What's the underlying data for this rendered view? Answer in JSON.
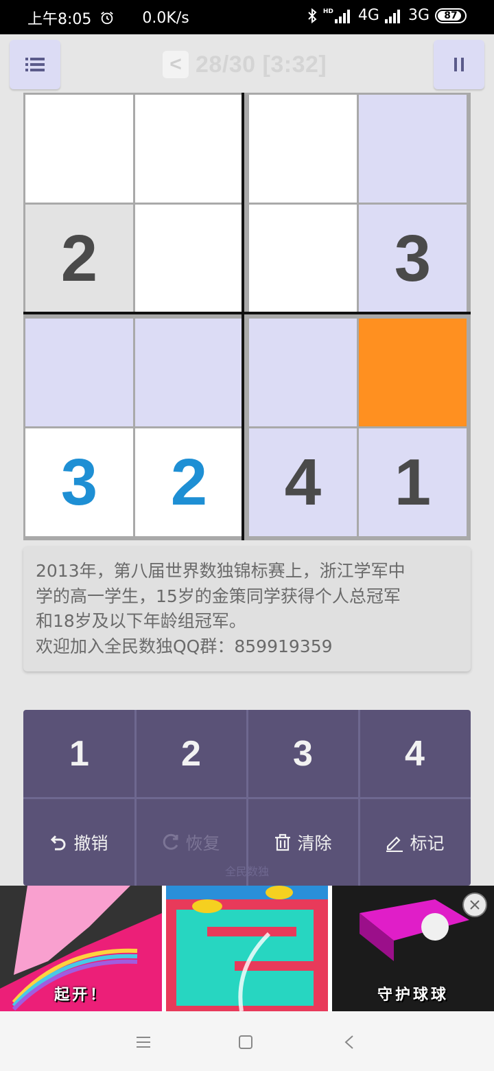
{
  "status_bar": {
    "time": "上午8:05",
    "net_speed": "0.0K/s",
    "net1": "4G",
    "net2": "3G",
    "hd": "HD",
    "battery": "87",
    "icons": [
      "alarm-icon",
      "bluetooth-icon",
      "signal-icon",
      "signal-icon"
    ]
  },
  "header": {
    "title": "28/30 [3:32]",
    "back_label": "<",
    "icons": [
      "menu-icon",
      "pause-icon"
    ]
  },
  "board": {
    "size": 4,
    "rows": [
      [
        {
          "v": "",
          "bg": "white"
        },
        {
          "v": "",
          "bg": "white"
        },
        {
          "v": "",
          "bg": "white"
        },
        {
          "v": "",
          "bg": "highlight"
        }
      ],
      [
        {
          "v": "2",
          "bg": "gray",
          "kind": "given"
        },
        {
          "v": "",
          "bg": "white"
        },
        {
          "v": "",
          "bg": "white"
        },
        {
          "v": "3",
          "bg": "highlight",
          "kind": "given"
        }
      ],
      [
        {
          "v": "",
          "bg": "highlight"
        },
        {
          "v": "",
          "bg": "highlight"
        },
        {
          "v": "",
          "bg": "highlight"
        },
        {
          "v": "",
          "bg": "selected"
        }
      ],
      [
        {
          "v": "3",
          "bg": "white",
          "kind": "user"
        },
        {
          "v": "2",
          "bg": "white",
          "kind": "user"
        },
        {
          "v": "4",
          "bg": "highlight",
          "kind": "given"
        },
        {
          "v": "1",
          "bg": "highlight",
          "kind": "given"
        }
      ]
    ]
  },
  "info": {
    "line1": "2013年，第八届世界数独锦标赛上，浙江学军中",
    "line2": "学的高一学生，15岁的金策同学获得个人总冠军",
    "line3": "和18岁及以下年龄组冠军。",
    "line4": "欢迎加入全民数独QQ群：859919359"
  },
  "keypad": {
    "numbers": [
      "1",
      "2",
      "3",
      "4"
    ],
    "actions": [
      {
        "label": "撤销",
        "icon": "undo-icon"
      },
      {
        "label": "恢复",
        "icon": "redo-icon"
      },
      {
        "label": "清除",
        "icon": "trash-icon"
      },
      {
        "label": "标记",
        "icon": "pencil-icon"
      }
    ],
    "ghost_text": "全民数独"
  },
  "ad": {
    "captions": [
      "起开！",
      "",
      "守护球球"
    ]
  },
  "colors": {
    "background": "#e6e6e6",
    "cell_white": "#ffffff",
    "cell_gray": "#e3e3e3",
    "cell_highlight": "#dcdcf5",
    "cell_selected": "#ff9020",
    "given_digit": "#4a4a4a",
    "user_digit": "#1e8fd4",
    "keypad": "#5a5277"
  }
}
